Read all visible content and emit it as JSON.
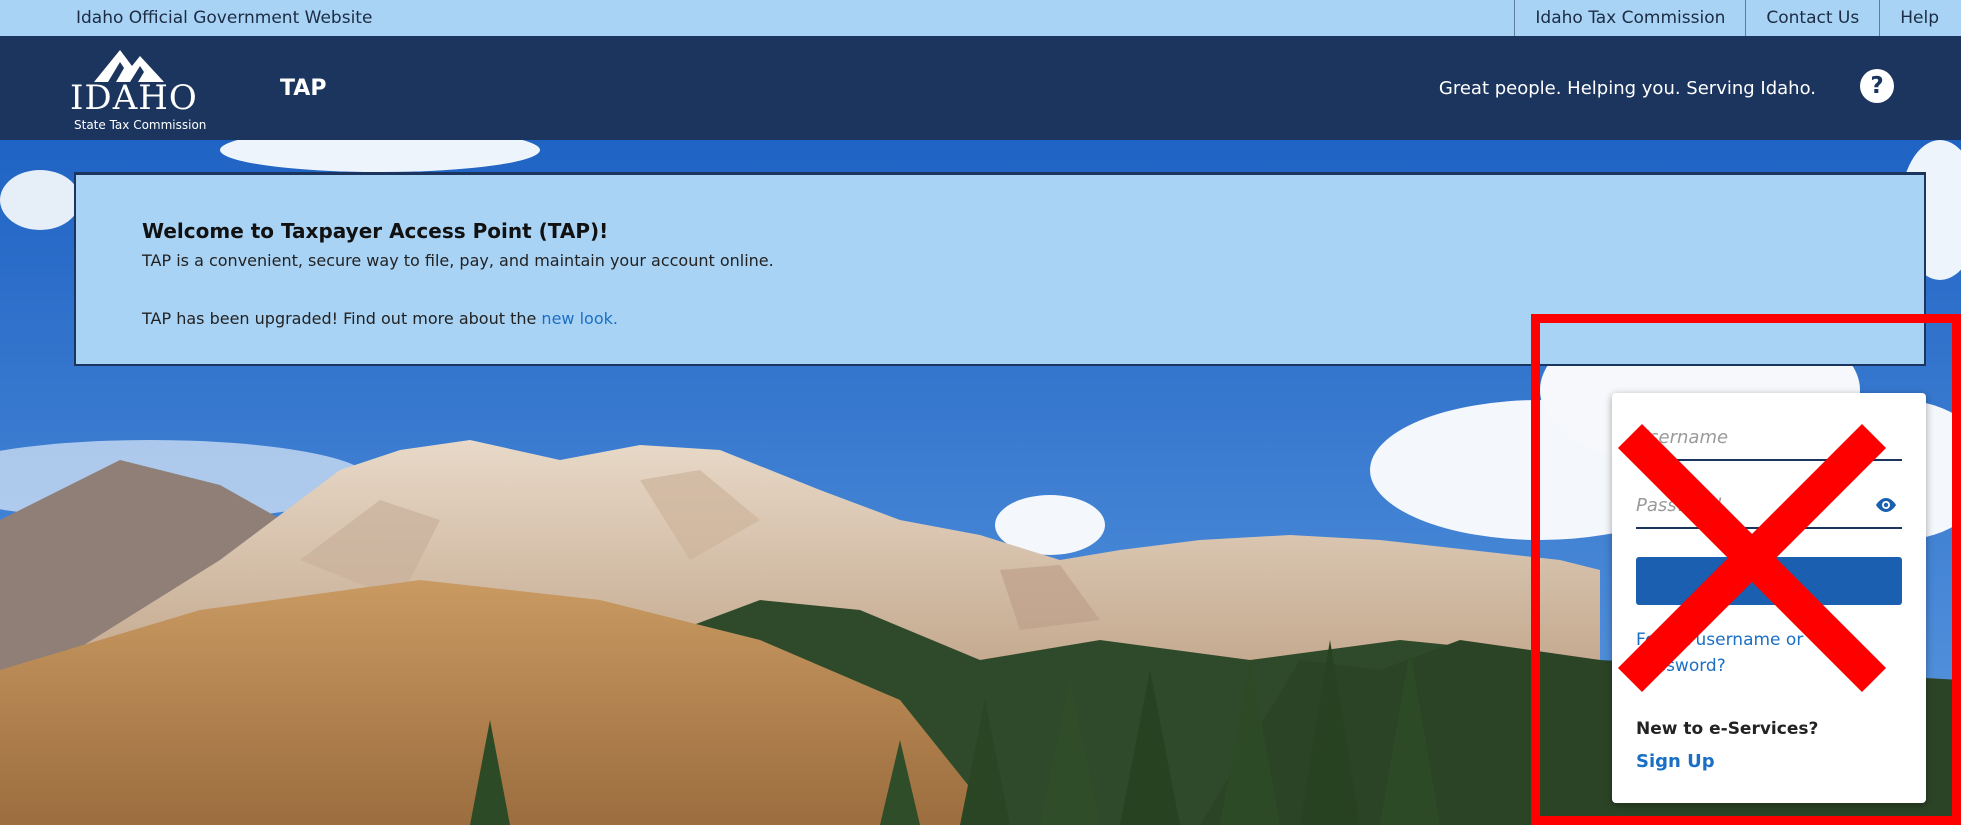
{
  "utility_bar": {
    "gov_label": "Idaho Official Government Website",
    "links": [
      "Idaho Tax Commission",
      "Contact Us",
      "Help"
    ]
  },
  "header": {
    "logo_word": "IDAHO",
    "logo_subtitle": "State Tax Commission",
    "app_name": "TAP",
    "tagline": "Great people. Helping you. Serving Idaho.",
    "help_symbol": "?"
  },
  "welcome": {
    "title": "Welcome to Taxpayer Access Point (TAP)!",
    "description": "TAP is a convenient, secure way to file, pay, and maintain your account online.",
    "upgrade_prefix": "TAP has been upgraded! Find out more about the ",
    "upgrade_link": "new look."
  },
  "login": {
    "username_placeholder": "Username",
    "password_placeholder": "Password",
    "forgot_link": "Forgot username or password?",
    "new_heading": "New to e-Services?",
    "signup_link": "Sign Up"
  },
  "colors": {
    "utility_bar_bg": "#a9d3f5",
    "header_bg": "#1c355e",
    "accent_blue": "#1a5fb0",
    "link_blue": "#1a6fc4",
    "annotation_red": "#ff0000"
  },
  "icons": {
    "help": "question-mark-icon",
    "password_toggle": "eye-icon",
    "annotation": "red-x-mark"
  }
}
